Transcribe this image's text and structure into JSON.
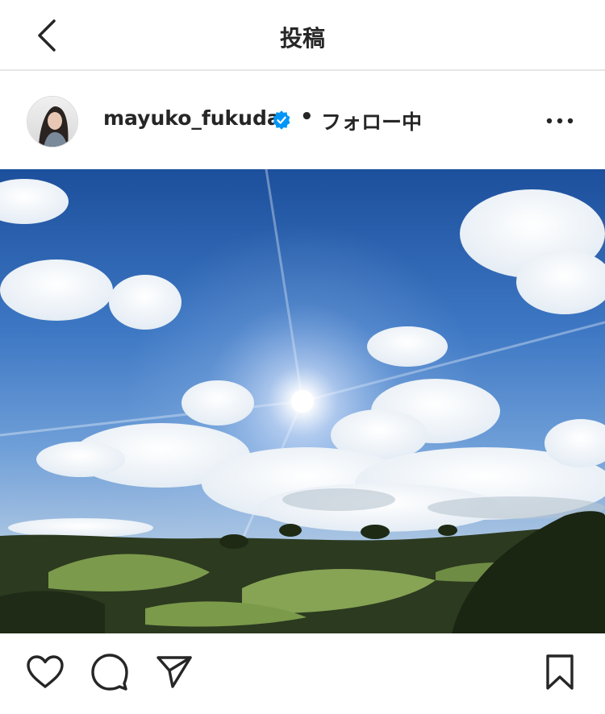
{
  "header": {
    "title": "投稿",
    "back_icon": "chevron-left-icon"
  },
  "post": {
    "username": "mayuko_fukuda",
    "verified": true,
    "separator": "•",
    "follow_status": "フォロー中",
    "more_icon": "more-horizontal-icon",
    "image_subject": "sunny sky over golf course"
  },
  "actions": {
    "like_icon": "heart-icon",
    "comment_icon": "comment-icon",
    "share_icon": "send-icon",
    "save_icon": "bookmark-icon"
  },
  "colors": {
    "verified_blue": "#0095f6",
    "text": "#262626",
    "divider": "#e6e6e6"
  }
}
